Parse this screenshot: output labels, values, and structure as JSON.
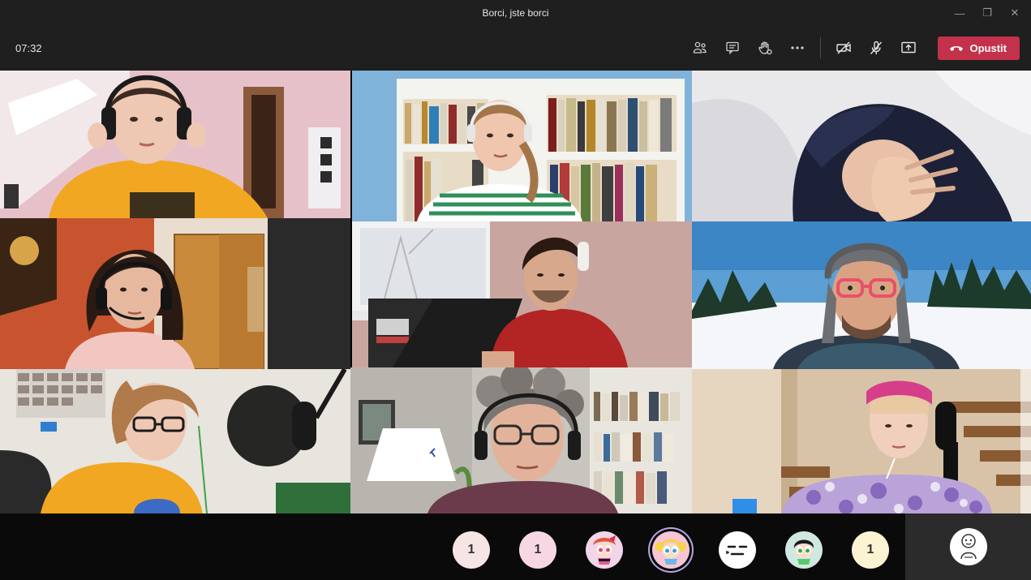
{
  "window": {
    "title": "Borci, jste borci",
    "controls": [
      "minimize-icon",
      "restore-icon",
      "close-icon"
    ]
  },
  "toolbar": {
    "timer": "07:32",
    "icons": [
      "people-icon",
      "chat-icon",
      "raise-hand-icon",
      "more-icon",
      "camera-off-icon",
      "mic-off-icon",
      "share-screen-icon"
    ],
    "leave_label": "Opustit",
    "leave_color": "#c4314b"
  },
  "participants_bar": {
    "avatars": [
      {
        "label": "1",
        "bg": "#f7e5e5"
      },
      {
        "label": "1",
        "bg": "#f8d7e5"
      },
      {
        "label": "",
        "icon": "powerpuff-blossom-icon",
        "bg": "#f2d5e8"
      },
      {
        "label": "",
        "icon": "powerpuff-bubbles-icon",
        "bg": "#f7c6d6",
        "active": true
      },
      {
        "label": "",
        "icon": "neutral-face-emoji-icon",
        "bg": "#ffffff"
      },
      {
        "label": "",
        "icon": "powerpuff-buttercup-icon",
        "bg": "#cfe9e2"
      },
      {
        "label": "1",
        "bg": "#fbf3d2"
      }
    ],
    "self_icon": "cartoon-character-icon"
  }
}
